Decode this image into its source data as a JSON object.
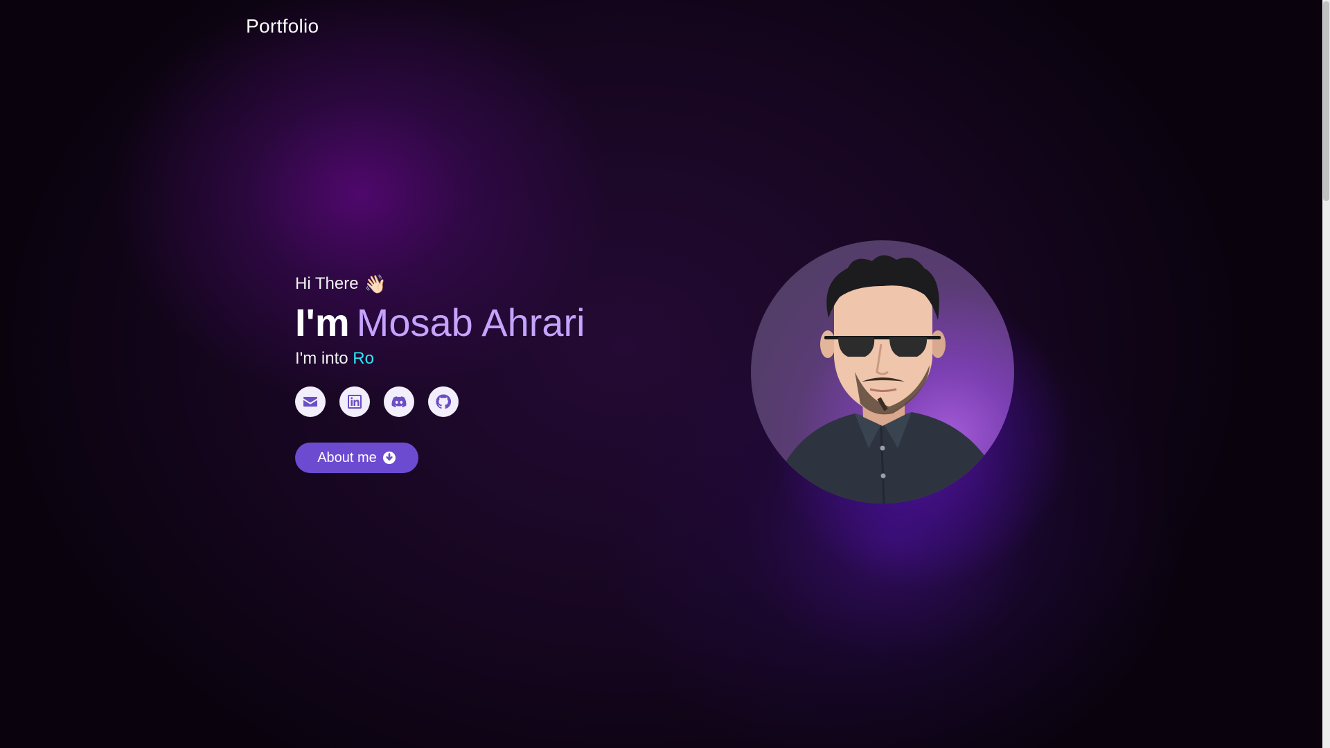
{
  "nav": {
    "brand": "Portfolio"
  },
  "hero": {
    "greeting": "Hi There",
    "wave_emoji": "👋🏻",
    "headline_prefix": "I'm",
    "name": "Mosab Ahrari",
    "into_prefix": "I'm into",
    "into_typed": "Ro",
    "about_button_label": "About me"
  },
  "socials": [
    {
      "icon": "email-icon"
    },
    {
      "icon": "linkedin-icon"
    },
    {
      "icon": "discord-icon"
    },
    {
      "icon": "github-icon"
    }
  ],
  "colors": {
    "accent_name": "#c5a3ff",
    "typed_text": "#2ee6f2",
    "button": "#6d4bd1",
    "background": "#0d0412"
  }
}
